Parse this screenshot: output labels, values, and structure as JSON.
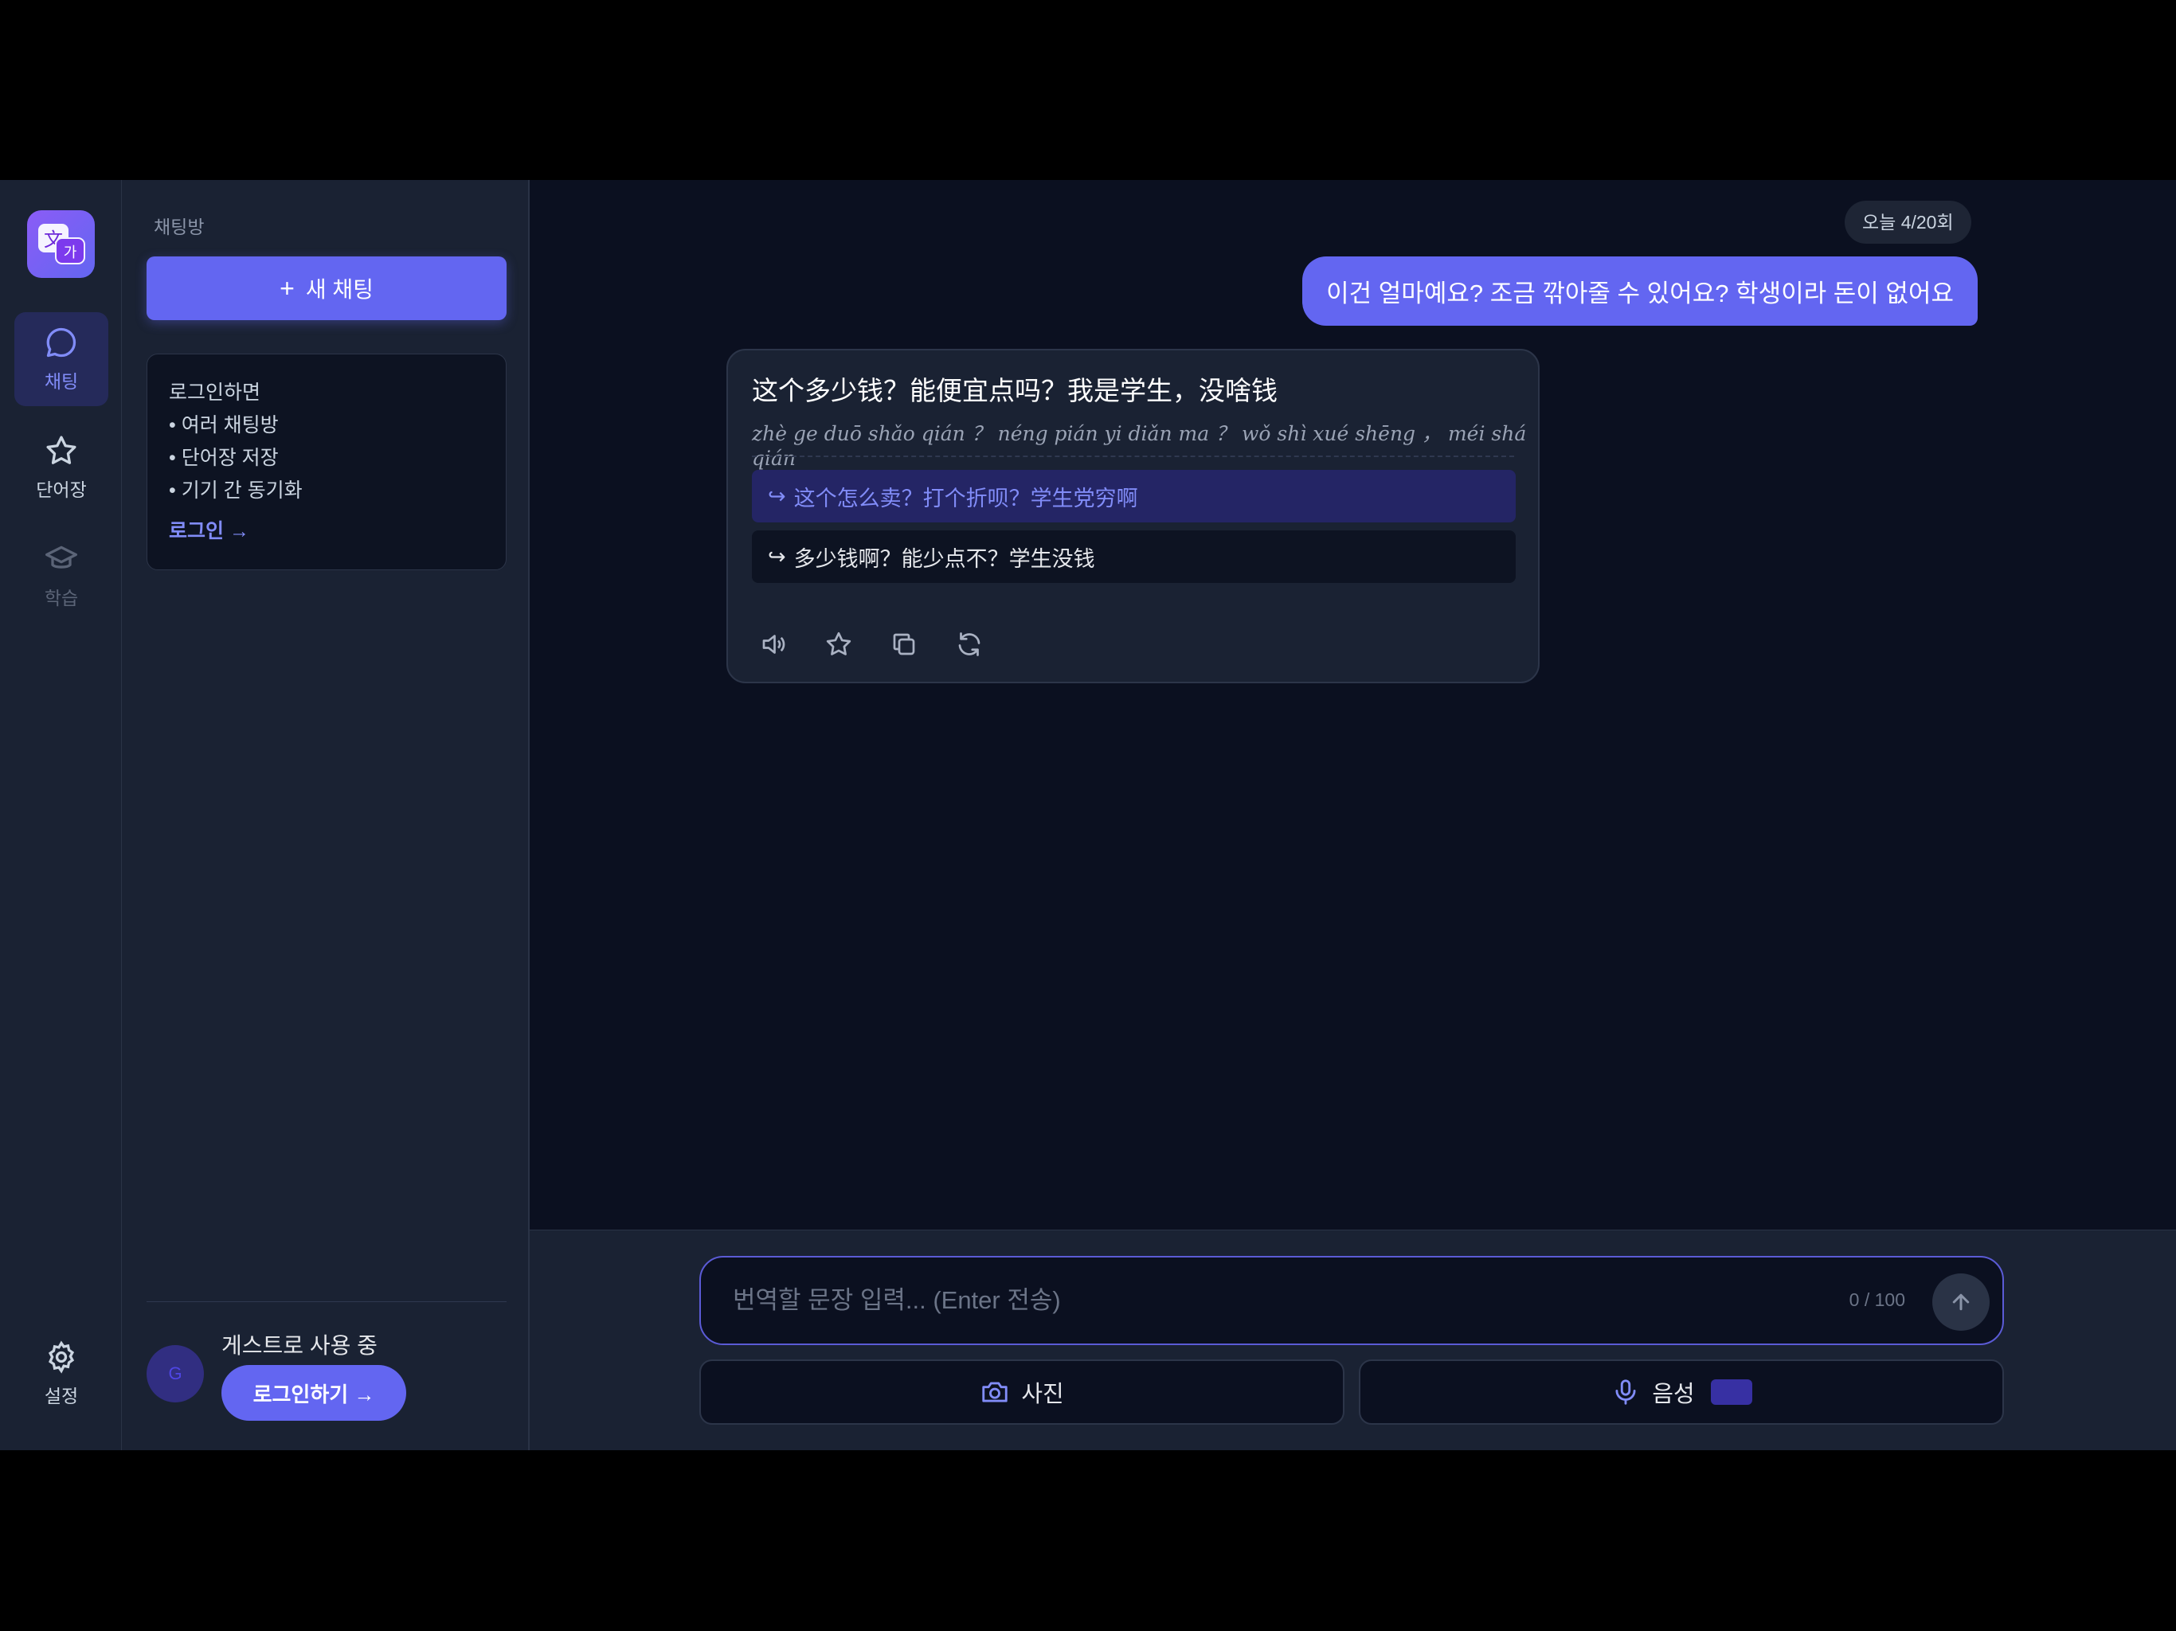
{
  "rail": {
    "items": [
      {
        "label": "채팅",
        "icon": "chat-bubble-icon"
      },
      {
        "label": "단어장",
        "icon": "star-icon"
      },
      {
        "label": "학습",
        "icon": "graduation-cap-icon"
      }
    ],
    "settings_label": "설정"
  },
  "panel": {
    "title": "채팅방",
    "new_chat_label": "새 채팅",
    "promo": {
      "heading": "로그인하면",
      "bullets": [
        "• 여러 채팅방",
        "• 단어장 저장",
        "• 기기 간 동기화"
      ],
      "link": "로그인 →"
    },
    "avatar_initial": "G",
    "guest_label": "게스트로 사용 중",
    "login_button": "로그인하기 →"
  },
  "chat": {
    "date_badge": "오늘 4/20회",
    "user_message": "이건 얼마예요? 조금 깎아줄 수 있어요? 학생이라 돈이 없어요",
    "translation": "这个多少钱？能便宜点吗？我是学生，没啥钱",
    "pinyin": "zhè ge duō shǎo qián ？ néng pián yi diǎn ma ？ wǒ shì xué shēng ， méi shá qián",
    "alternatives": [
      "这个怎么卖？打个折呗？学生党穷啊",
      "多少钱啊？能少点不？学生没钱"
    ]
  },
  "composer": {
    "placeholder": "번역할 문장 입력... (Enter 전송)",
    "counter": "0 / 100",
    "photo_label": "사진",
    "voice_label": "음성"
  },
  "colors": {
    "accent": "#6366f1",
    "background": "#0b1020",
    "panel": "#1a2233"
  }
}
